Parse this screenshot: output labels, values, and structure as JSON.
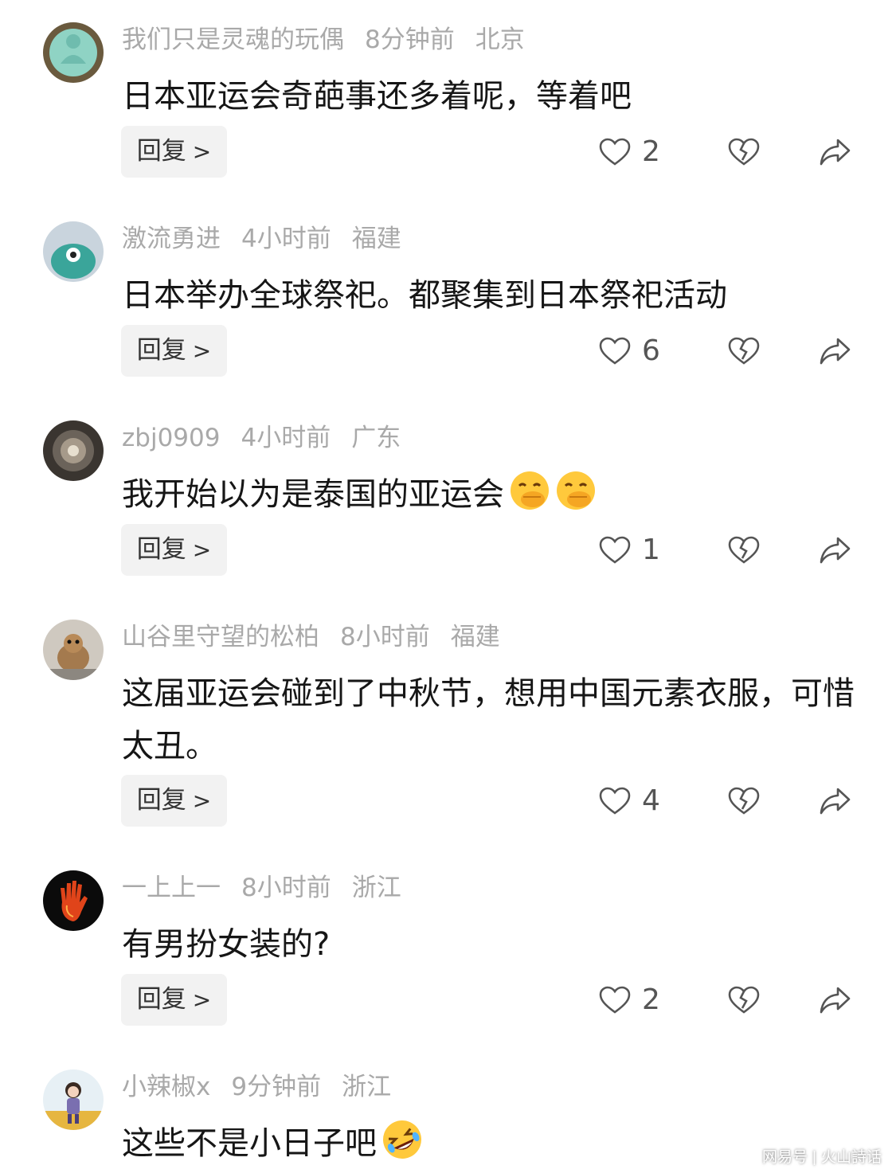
{
  "reply_label": "回复",
  "comments": [
    {
      "username": "我们只是灵魂的玩偶",
      "time": "8分钟前",
      "location": "北京",
      "text": "日本亚运会奇葩事还多着呢，等着吧",
      "likes": "2",
      "avatar": "jade-buddha-avatar"
    },
    {
      "username": "激流勇进",
      "time": "4小时前",
      "location": "福建",
      "text": "日本举办全球祭祀。都聚集到日本祭祀活动",
      "likes": "6",
      "avatar": "teal-creature-avatar"
    },
    {
      "username": "zbj0909",
      "time": "4小时前",
      "location": "广东",
      "text": "我开始以为是泰国的亚运会",
      "likes": "1",
      "avatar": "tunnel-avatar",
      "emojis": [
        "face-with-hand-over-mouth",
        "face-with-hand-over-mouth"
      ]
    },
    {
      "username": "山谷里守望的松柏",
      "time": "8小时前",
      "location": "福建",
      "text": "这届亚运会碰到了中秋节，想用中国元素衣服，可惜太丑。",
      "likes": "4",
      "avatar": "hamster-avatar"
    },
    {
      "username": "一上上一",
      "time": "8小时前",
      "location": "浙江",
      "text": "有男扮女装的?",
      "likes": "2",
      "avatar": "fire-hand-avatar"
    },
    {
      "username": "小辣椒x",
      "time": "9分钟前",
      "location": "浙江",
      "text": "这些不是小日子吧",
      "avatar": "girl-illustration-avatar",
      "emojis": [
        "rolling-on-floor-laughing"
      ]
    }
  ],
  "watermark": {
    "left": "网易号",
    "right": "火山詩话"
  }
}
